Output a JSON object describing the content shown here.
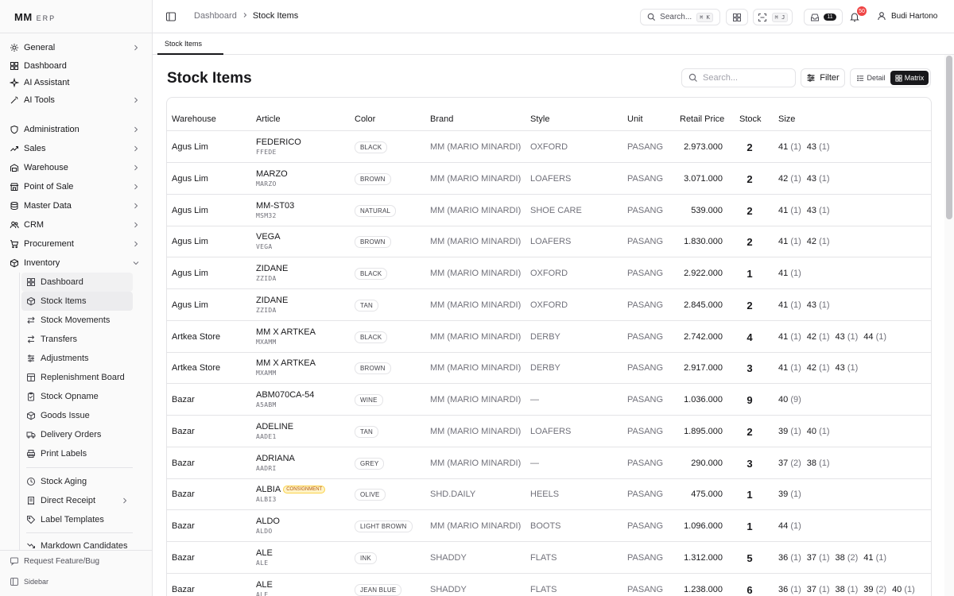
{
  "app": {
    "logo_main": "MM",
    "logo_sub": "ERP"
  },
  "sidebar": {
    "top_items": [
      {
        "label": "General",
        "icon": "settings-icon"
      },
      {
        "label": "Dashboard",
        "icon": "layout-grid-icon"
      },
      {
        "label": "AI Assistant",
        "icon": "sparkle-icon"
      },
      {
        "label": "AI Tools",
        "icon": "wand-icon"
      }
    ],
    "modules": [
      {
        "label": "Administration",
        "icon": "shield-icon"
      },
      {
        "label": "Sales",
        "icon": "trending-up-icon"
      },
      {
        "label": "Warehouse",
        "icon": "warehouse-icon"
      },
      {
        "label": "Point of Sale",
        "icon": "store-icon"
      },
      {
        "label": "Master Data",
        "icon": "database-icon"
      },
      {
        "label": "CRM",
        "icon": "users-icon"
      },
      {
        "label": "Procurement",
        "icon": "cart-icon"
      },
      {
        "label": "Inventory",
        "icon": "package-icon"
      }
    ],
    "inventory_sub": [
      {
        "label": "Dashboard",
        "icon": "layout-grid-icon"
      },
      {
        "label": "Stock Items",
        "icon": "package-icon"
      },
      {
        "label": "Stock Movements",
        "icon": "arrows-icon"
      },
      {
        "label": "Transfers",
        "icon": "transfer-icon"
      },
      {
        "label": "Adjustments",
        "icon": "sliders-icon"
      },
      {
        "label": "Replenishment Board",
        "icon": "board-icon"
      },
      {
        "label": "Stock Opname",
        "icon": "clipboard-icon"
      },
      {
        "label": "Goods Issue",
        "icon": "box-icon"
      },
      {
        "label": "Delivery Orders",
        "icon": "truck-icon"
      },
      {
        "label": "Print Labels",
        "icon": "printer-icon"
      },
      {
        "label": "Stock Aging",
        "icon": "clock-icon"
      },
      {
        "label": "Direct Receipt",
        "icon": "receipt-icon"
      },
      {
        "label": "Label Templates",
        "icon": "tag-icon"
      },
      {
        "label": "Markdown Candidates",
        "icon": "trending-down-icon"
      }
    ],
    "footer": {
      "request": "Request Feature/Bug",
      "sidebar": "Sidebar"
    }
  },
  "header": {
    "breadcrumb": {
      "parent": "Dashboard",
      "current": "Stock Items"
    },
    "search_label": "Search...",
    "search_kbd": "⌘ K",
    "scan_kbd": "⌘ J",
    "inbox_count": "11",
    "notification_count": "50",
    "user_name": "Budi Hartono"
  },
  "tabs": [
    {
      "label": "Stock Items"
    }
  ],
  "main": {
    "title": "Stock Items",
    "search_placeholder": "Search...",
    "filter_label": "Filter",
    "view_detail": "Detail",
    "view_matrix": "Matrix"
  },
  "table": {
    "columns": {
      "warehouse": "Warehouse",
      "article": "Article",
      "color": "Color",
      "brand": "Brand",
      "style": "Style",
      "unit": "Unit",
      "price": "Retail Price",
      "stock": "Stock",
      "size": "Size"
    },
    "rows": [
      {
        "warehouse": "Agus Lim",
        "article": "FEDERICO",
        "code": "FFEDE",
        "badge": "",
        "color": "BLACK",
        "brand": "MM (MARIO MINARDI)",
        "style": "OXFORD",
        "unit": "PASANG",
        "price": "2.973.000",
        "stock": "2",
        "sizes": [
          {
            "s": "41",
            "q": "(1)"
          },
          {
            "s": "43",
            "q": "(1)"
          }
        ]
      },
      {
        "warehouse": "Agus Lim",
        "article": "MARZO",
        "code": "MARZO",
        "badge": "",
        "color": "BROWN",
        "brand": "MM (MARIO MINARDI)",
        "style": "LOAFERS",
        "unit": "PASANG",
        "price": "3.071.000",
        "stock": "2",
        "sizes": [
          {
            "s": "42",
            "q": "(1)"
          },
          {
            "s": "43",
            "q": "(1)"
          }
        ]
      },
      {
        "warehouse": "Agus Lim",
        "article": "MM-ST03",
        "code": "MSM32",
        "badge": "",
        "color": "NATURAL",
        "brand": "MM (MARIO MINARDI)",
        "style": "SHOE CARE",
        "unit": "PASANG",
        "price": "539.000",
        "stock": "2",
        "sizes": [
          {
            "s": "41",
            "q": "(1)"
          },
          {
            "s": "43",
            "q": "(1)"
          }
        ]
      },
      {
        "warehouse": "Agus Lim",
        "article": "VEGA",
        "code": "VEGA",
        "badge": "",
        "color": "BROWN",
        "brand": "MM (MARIO MINARDI)",
        "style": "LOAFERS",
        "unit": "PASANG",
        "price": "1.830.000",
        "stock": "2",
        "sizes": [
          {
            "s": "41",
            "q": "(1)"
          },
          {
            "s": "42",
            "q": "(1)"
          }
        ]
      },
      {
        "warehouse": "Agus Lim",
        "article": "ZIDANE",
        "code": "ZZIDA",
        "badge": "",
        "color": "BLACK",
        "brand": "MM (MARIO MINARDI)",
        "style": "OXFORD",
        "unit": "PASANG",
        "price": "2.922.000",
        "stock": "1",
        "sizes": [
          {
            "s": "41",
            "q": "(1)"
          }
        ]
      },
      {
        "warehouse": "Agus Lim",
        "article": "ZIDANE",
        "code": "ZZIDA",
        "badge": "",
        "color": "TAN",
        "brand": "MM (MARIO MINARDI)",
        "style": "OXFORD",
        "unit": "PASANG",
        "price": "2.845.000",
        "stock": "2",
        "sizes": [
          {
            "s": "41",
            "q": "(1)"
          },
          {
            "s": "43",
            "q": "(1)"
          }
        ]
      },
      {
        "warehouse": "Artkea Store",
        "article": "MM X ARTKEA",
        "code": "MXAMM",
        "badge": "",
        "color": "BLACK",
        "brand": "MM (MARIO MINARDI)",
        "style": "DERBY",
        "unit": "PASANG",
        "price": "2.742.000",
        "stock": "4",
        "sizes": [
          {
            "s": "41",
            "q": "(1)"
          },
          {
            "s": "42",
            "q": "(1)"
          },
          {
            "s": "43",
            "q": "(1)"
          },
          {
            "s": "44",
            "q": "(1)"
          }
        ]
      },
      {
        "warehouse": "Artkea Store",
        "article": "MM X ARTKEA",
        "code": "MXAMM",
        "badge": "",
        "color": "BROWN",
        "brand": "MM (MARIO MINARDI)",
        "style": "DERBY",
        "unit": "PASANG",
        "price": "2.917.000",
        "stock": "3",
        "sizes": [
          {
            "s": "41",
            "q": "(1)"
          },
          {
            "s": "42",
            "q": "(1)"
          },
          {
            "s": "43",
            "q": "(1)"
          }
        ]
      },
      {
        "warehouse": "Bazar",
        "article": "ABM070CA-54",
        "code": "A5ABM",
        "badge": "",
        "color": "WINE",
        "brand": "MM (MARIO MINARDI)",
        "style": "—",
        "unit": "PASANG",
        "price": "1.036.000",
        "stock": "9",
        "sizes": [
          {
            "s": "40",
            "q": "(9)"
          }
        ]
      },
      {
        "warehouse": "Bazar",
        "article": "ADELINE",
        "code": "AADE1",
        "badge": "",
        "color": "TAN",
        "brand": "MM (MARIO MINARDI)",
        "style": "LOAFERS",
        "unit": "PASANG",
        "price": "1.895.000",
        "stock": "2",
        "sizes": [
          {
            "s": "39",
            "q": "(1)"
          },
          {
            "s": "40",
            "q": "(1)"
          }
        ]
      },
      {
        "warehouse": "Bazar",
        "article": "ADRIANA",
        "code": "AADRI",
        "badge": "",
        "color": "GREY",
        "brand": "MM (MARIO MINARDI)",
        "style": "—",
        "unit": "PASANG",
        "price": "290.000",
        "stock": "3",
        "sizes": [
          {
            "s": "37",
            "q": "(2)"
          },
          {
            "s": "38",
            "q": "(1)"
          }
        ]
      },
      {
        "warehouse": "Bazar",
        "article": "ALBIA",
        "code": "ALBI3",
        "badge": "CONSIGNMENT",
        "color": "OLIVE",
        "brand": "SHD.DAILY",
        "style": "HEELS",
        "unit": "PASANG",
        "price": "475.000",
        "stock": "1",
        "sizes": [
          {
            "s": "39",
            "q": "(1)"
          }
        ]
      },
      {
        "warehouse": "Bazar",
        "article": "ALDO",
        "code": "ALDO",
        "badge": "",
        "color": "LIGHT BROWN",
        "brand": "MM (MARIO MINARDI)",
        "style": "BOOTS",
        "unit": "PASANG",
        "price": "1.096.000",
        "stock": "1",
        "sizes": [
          {
            "s": "44",
            "q": "(1)"
          }
        ]
      },
      {
        "warehouse": "Bazar",
        "article": "ALE",
        "code": "ALE",
        "badge": "",
        "color": "INK",
        "brand": "SHADDY",
        "style": "FLATS",
        "unit": "PASANG",
        "price": "1.312.000",
        "stock": "5",
        "sizes": [
          {
            "s": "36",
            "q": "(1)"
          },
          {
            "s": "37",
            "q": "(1)"
          },
          {
            "s": "38",
            "q": "(2)"
          },
          {
            "s": "41",
            "q": "(1)"
          }
        ]
      },
      {
        "warehouse": "Bazar",
        "article": "ALE",
        "code": "ALE",
        "badge": "",
        "color": "JEAN BLUE",
        "brand": "SHADDY",
        "style": "FLATS",
        "unit": "PASANG",
        "price": "1.238.000",
        "stock": "6",
        "sizes": [
          {
            "s": "36",
            "q": "(1)"
          },
          {
            "s": "37",
            "q": "(1)"
          },
          {
            "s": "38",
            "q": "(1)"
          },
          {
            "s": "39",
            "q": "(2)"
          },
          {
            "s": "40",
            "q": "(1)"
          }
        ]
      }
    ]
  },
  "colors": {
    "accent": "#18181b",
    "badge_red": "#ef4444",
    "border": "#e4e4e7",
    "muted": "#71717a"
  }
}
